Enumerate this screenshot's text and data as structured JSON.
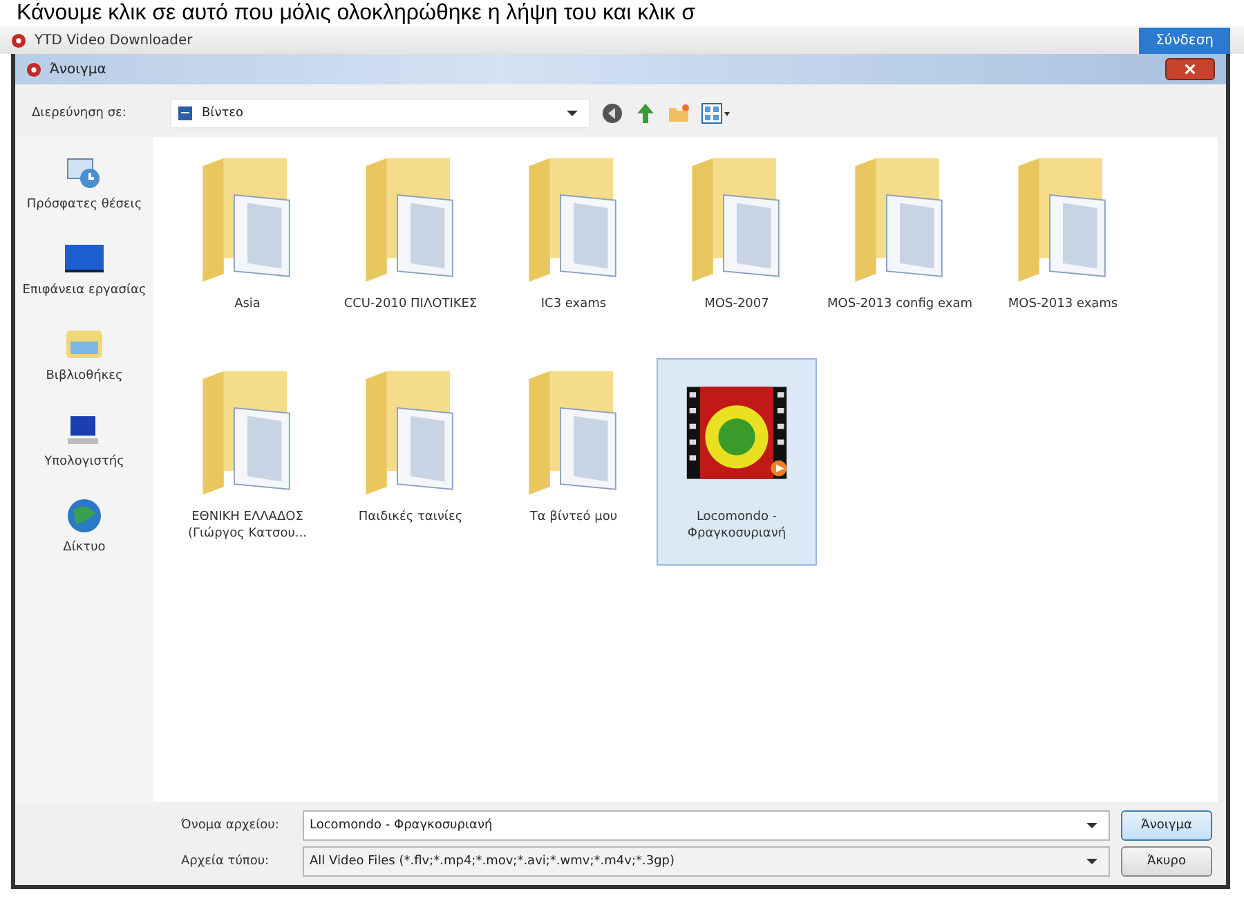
{
  "caption": "Κάνουμε κλικ σε αυτό που μόλις ολοκληρώθηκε η λήψη του και κλικ σ",
  "app": {
    "title": "YTD Video Downloader",
    "button": "Σύνδεση"
  },
  "dialog": {
    "title": "Άνοιγμα",
    "look_in_label": "Διερεύνηση σε:",
    "look_in_value": "Βίντεο"
  },
  "sidebar": {
    "items": [
      {
        "label": "Πρόσφατες θέσεις",
        "kind": "recent"
      },
      {
        "label": "Επιφάνεια εργασίας",
        "kind": "desktop"
      },
      {
        "label": "Βιβλιοθήκες",
        "kind": "libraries"
      },
      {
        "label": "Υπολογιστής",
        "kind": "computer"
      },
      {
        "label": "Δίκτυο",
        "kind": "network"
      }
    ]
  },
  "files": [
    {
      "name": "Asia",
      "kind": "folder",
      "selected": false
    },
    {
      "name": "CCU-2010 ΠΙΛΟΤΙΚΕΣ",
      "kind": "folder",
      "selected": false
    },
    {
      "name": "IC3 exams",
      "kind": "folder",
      "selected": false
    },
    {
      "name": "MOS-2007",
      "kind": "folder",
      "selected": false
    },
    {
      "name": "MOS-2013 config exam",
      "kind": "folder",
      "selected": false
    },
    {
      "name": "MOS-2013 exams",
      "kind": "folder",
      "selected": false
    },
    {
      "name": "ΕΘΝΙΚΗ ΕΛΛΑΔΟΣ (Γιώργος Κατσου...",
      "kind": "folder",
      "selected": false
    },
    {
      "name": "Παιδικές ταινίες",
      "kind": "folder",
      "selected": false
    },
    {
      "name": "Τα βίντεό μου",
      "kind": "folder",
      "selected": false
    },
    {
      "name": "Locomondo - Φραγκοσυριανή",
      "kind": "video",
      "selected": true
    }
  ],
  "file_name": {
    "label": "Όνομα αρχείου:",
    "value": "Locomondo - Φραγκοσυριανή"
  },
  "file_type": {
    "label": "Αρχεία τύπου:",
    "value": "All Video Files (*.flv;*.mp4;*.mov;*.avi;*.wmv;*.m4v;*.3gp)"
  },
  "buttons": [
    "Άνοιγμα",
    "Άκυρο"
  ]
}
